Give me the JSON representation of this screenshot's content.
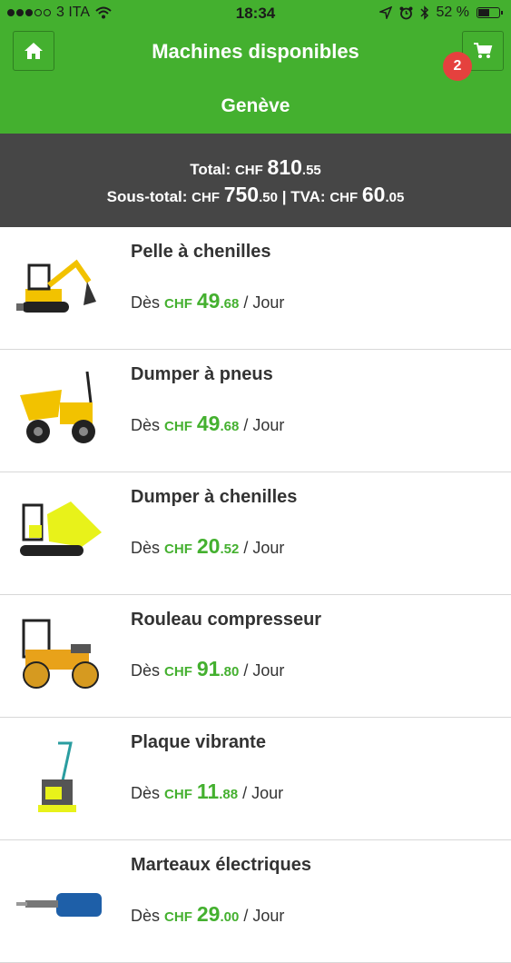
{
  "status_bar": {
    "carrier": "3 ITA",
    "time": "18:34",
    "battery": "52 %",
    "battery_level": 0.52
  },
  "header": {
    "title": "Machines disponibles",
    "city": "Genève",
    "cart_count": "2"
  },
  "totals": {
    "total_label": "Total:",
    "total_currency": "CHF",
    "total_int": "810",
    "total_dec": ".55",
    "subtotal_label": "Sous-total:",
    "subtotal_currency": "CHF",
    "subtotal_int": "750",
    "subtotal_dec": ".50",
    "separator": "|",
    "tva_label": "TVA:",
    "tva_currency": "CHF",
    "tva_int": "60",
    "tva_dec": ".05"
  },
  "colors": {
    "brand_green": "#44b02f",
    "totals_bg": "#464646",
    "badge_red": "#e5413e"
  },
  "machines": [
    {
      "name": "Pelle à chenilles",
      "from": "Dès",
      "currency": "CHF",
      "price_int": "49",
      "price_dec": ".68",
      "unit": "/ Jour",
      "icon": "mini-excavator-image"
    },
    {
      "name": "Dumper à pneus",
      "from": "Dès",
      "currency": "CHF",
      "price_int": "49",
      "price_dec": ".68",
      "unit": "/ Jour",
      "icon": "wheel-dumper-image"
    },
    {
      "name": "Dumper à chenilles",
      "from": "Dès",
      "currency": "CHF",
      "price_int": "20",
      "price_dec": ".52",
      "unit": "/ Jour",
      "icon": "track-dumper-image"
    },
    {
      "name": "Rouleau compresseur",
      "from": "Dès",
      "currency": "CHF",
      "price_int": "91",
      "price_dec": ".80",
      "unit": "/ Jour",
      "icon": "road-roller-image"
    },
    {
      "name": "Plaque vibrante",
      "from": "Dès",
      "currency": "CHF",
      "price_int": "11",
      "price_dec": ".88",
      "unit": "/ Jour",
      "icon": "plate-compactor-image"
    },
    {
      "name": "Marteaux électriques",
      "from": "Dès",
      "currency": "CHF",
      "price_int": "29",
      "price_dec": ".00",
      "unit": "/ Jour",
      "icon": "electric-hammer-image"
    }
  ]
}
